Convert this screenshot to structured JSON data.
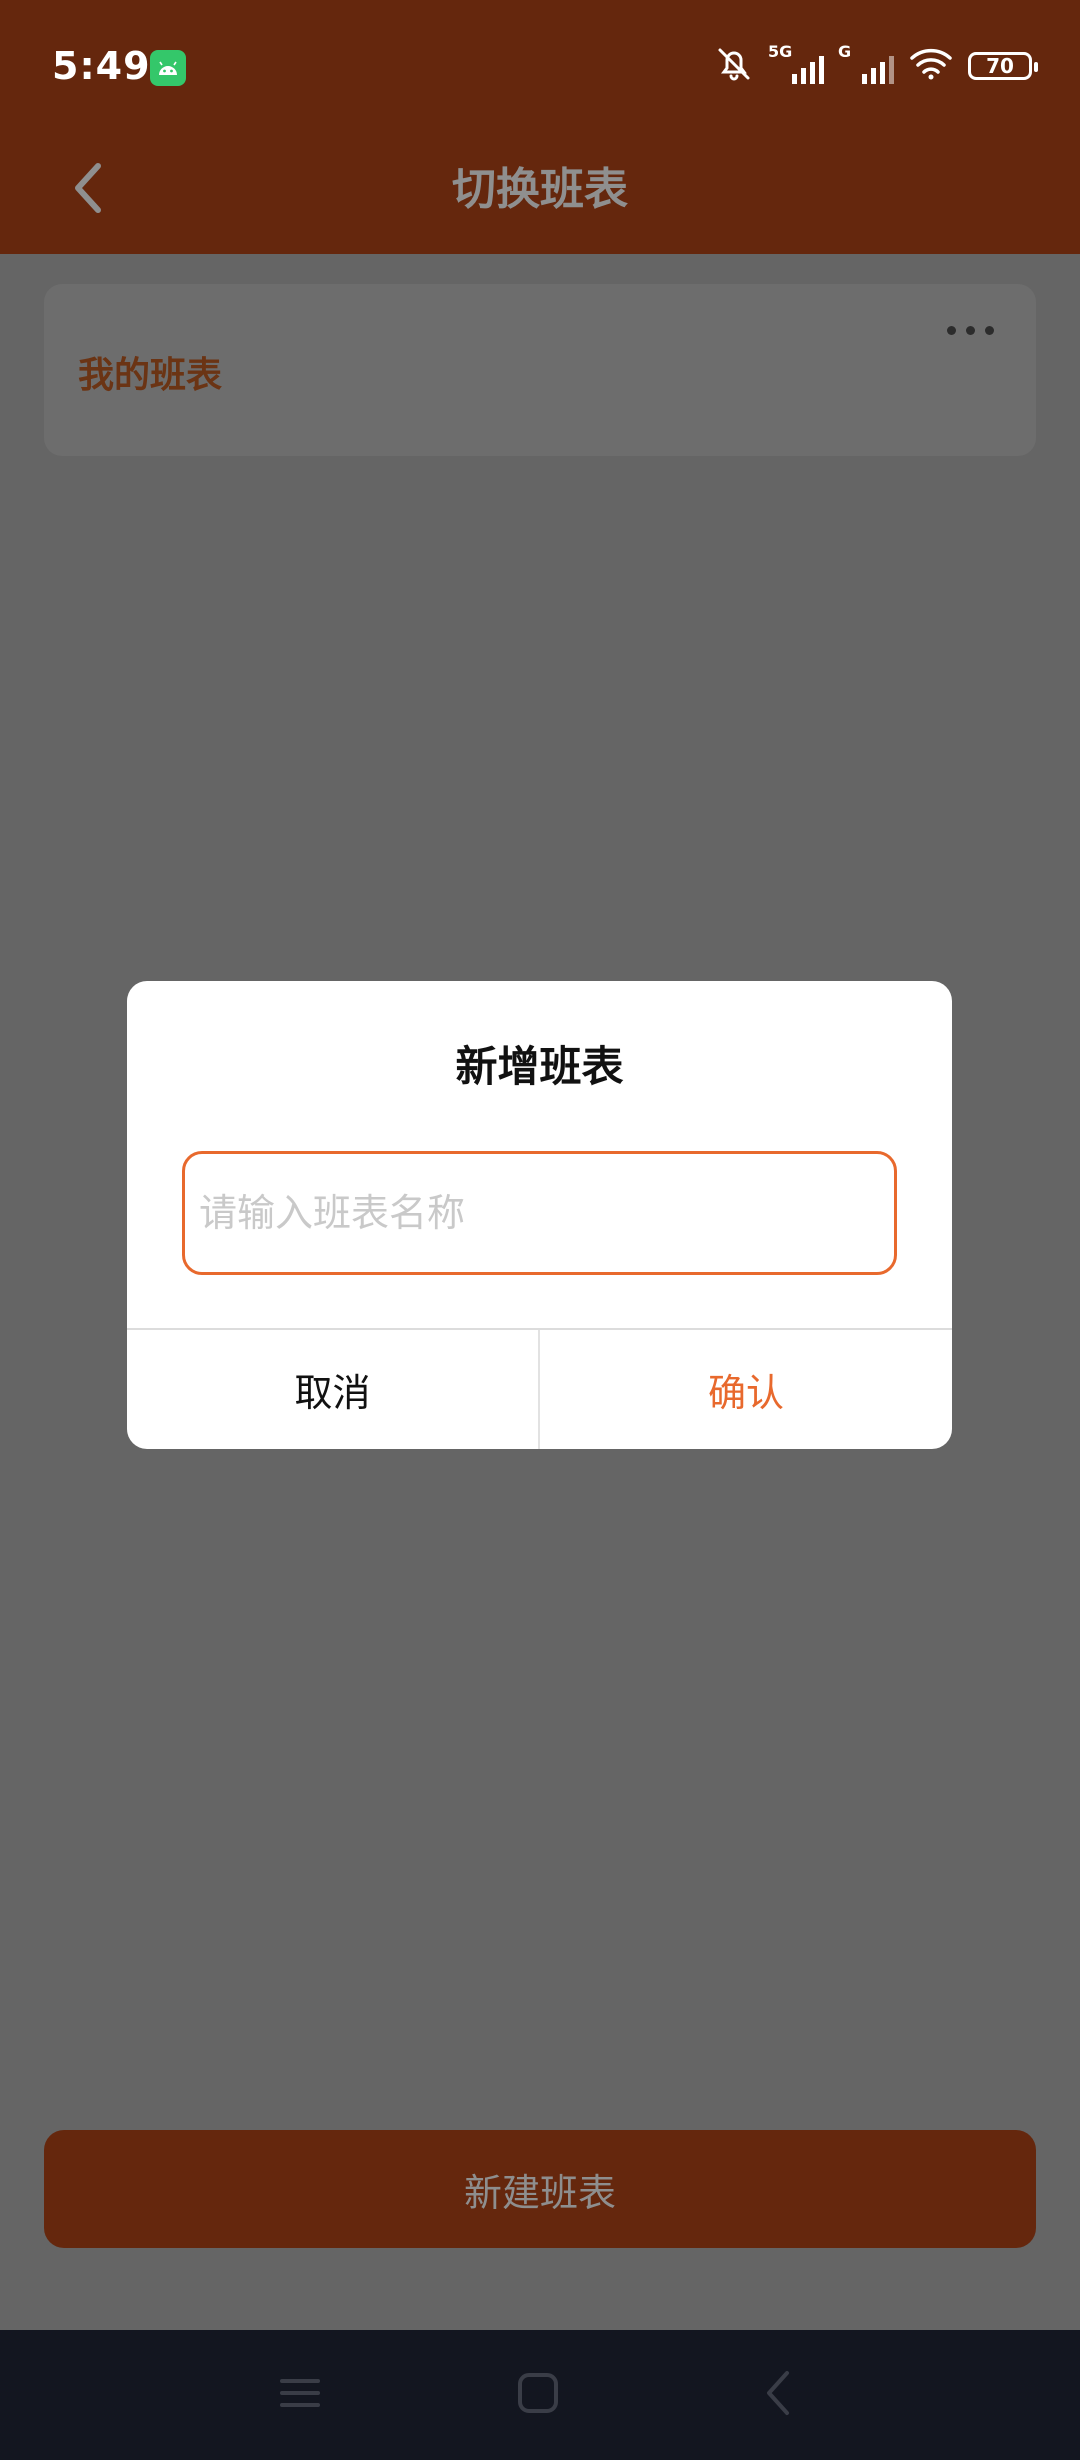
{
  "status_bar": {
    "time": "5:49",
    "network_1": "5G",
    "network_2": "G",
    "battery": "70",
    "icons": [
      "android-app-icon",
      "bell-muted-icon",
      "signal-icon",
      "wifi-icon",
      "battery-icon"
    ]
  },
  "header": {
    "title": "切换班表",
    "back_icon": "chevron-left-icon"
  },
  "schedule_card": {
    "title": "我的班表",
    "more_icon": "more-horizontal-icon"
  },
  "new_schedule_button": {
    "label": "新建班表"
  },
  "dialog": {
    "title": "新增班表",
    "input_value": "",
    "input_placeholder": "请输入班表名称",
    "cancel_label": "取消",
    "confirm_label": "确认"
  },
  "nav_bar": {
    "icons": [
      "menu-icon",
      "home-square-icon",
      "back-chevron-icon"
    ]
  },
  "colors": {
    "brand_dimmed": "#65270d",
    "accent": "#e8692d",
    "overlay": "#656565",
    "nav_background": "#131620"
  }
}
